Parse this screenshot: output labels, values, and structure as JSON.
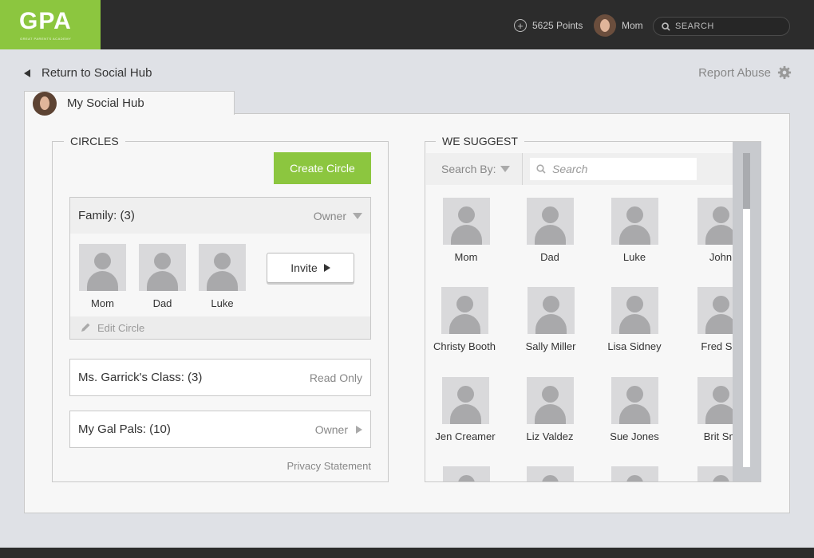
{
  "header": {
    "logo_text": "GPA",
    "logo_subtitle": "GREAT PARENTS ACADEMY",
    "points": "5625 Points",
    "user_name": "Mom",
    "search_placeholder": "SEARCH"
  },
  "nav": {
    "return_label": "Return to Social Hub",
    "report_label": "Report Abuse"
  },
  "tab": {
    "label": "My Social Hub"
  },
  "circles": {
    "legend": "CIRCLES",
    "create_label": "Create Circle",
    "family": {
      "name": "Family: (3)",
      "role": "Owner",
      "members": [
        "Mom",
        "Dad",
        "Luke"
      ],
      "invite_label": "Invite",
      "edit_label": "Edit Circle"
    },
    "class_circle": {
      "name": "Ms. Garrick's Class: (3)",
      "role": "Read Only"
    },
    "gal_circle": {
      "name": "My Gal Pals: (10)",
      "role": "Owner"
    },
    "privacy_label": "Privacy Statement"
  },
  "suggest": {
    "legend": "WE SUGGEST",
    "search_by_label": "Search By:",
    "search_placeholder": "Search",
    "people": [
      "Mom",
      "Dad",
      "Luke",
      "John",
      "Christy Booth",
      "Sally Miller",
      "Lisa Sidney",
      "Fred Sin",
      "Jen Creamer",
      "Liz Valdez",
      "Sue Jones",
      "Brit Sm",
      "",
      "",
      "",
      ""
    ]
  },
  "colors": {
    "brand_green": "#8cc63f",
    "topbar": "#2c2c2c",
    "background": "#dfe1e6"
  }
}
